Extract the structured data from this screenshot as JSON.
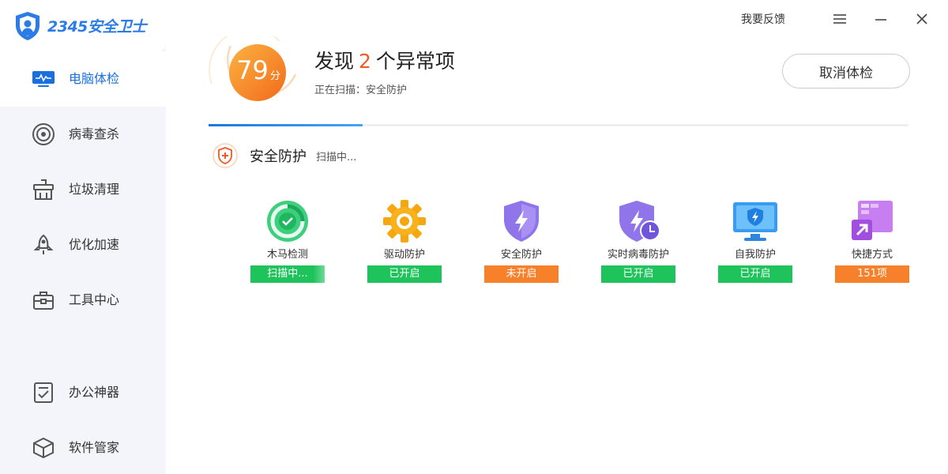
{
  "app": {
    "logo_text": "2345安全卫士"
  },
  "sidebar": {
    "items": [
      {
        "label": "电脑体检",
        "icon": "monitor-icon",
        "active": true
      },
      {
        "label": "病毒查杀",
        "icon": "target-icon",
        "active": false
      },
      {
        "label": "垃圾清理",
        "icon": "broom-icon",
        "active": false
      },
      {
        "label": "优化加速",
        "icon": "rocket-icon",
        "active": false
      },
      {
        "label": "工具中心",
        "icon": "toolbox-icon",
        "active": false
      },
      {
        "label": "办公神器",
        "icon": "checklist-icon",
        "active": false
      },
      {
        "label": "软件管家",
        "icon": "box-icon",
        "active": false
      }
    ]
  },
  "window": {
    "feedback_label": "我要反馈",
    "menu_icon": "hamburger-icon",
    "minimize_icon": "minimize-icon",
    "close_icon": "close-icon"
  },
  "header": {
    "score": "79",
    "score_unit": "分",
    "headline_prefix": "发现",
    "issue_count": "2",
    "headline_suffix": "个异常项",
    "scanning_text": "正在扫描：安全防护",
    "cancel_label": "取消体检",
    "progress": 0.22
  },
  "section": {
    "title": "安全防护",
    "status": "扫描中..."
  },
  "items": [
    {
      "label": "木马检测",
      "status": "扫描中...",
      "icon": "trojan-scan-icon",
      "tone": "scan"
    },
    {
      "label": "驱动防护",
      "status": "已开启",
      "icon": "gear-icon",
      "tone": "green"
    },
    {
      "label": "安全防护",
      "status": "未开启",
      "icon": "shield-bolt-icon",
      "tone": "orange"
    },
    {
      "label": "实时病毒防护",
      "status": "已开启",
      "icon": "shield-clock-icon",
      "tone": "green"
    },
    {
      "label": "自我防护",
      "status": "已开启",
      "icon": "monitor-shield-icon",
      "tone": "green"
    },
    {
      "label": "快捷方式",
      "status": "151项",
      "icon": "shortcut-icon",
      "tone": "orange"
    }
  ],
  "colors": {
    "accent_blue": "#1a6fe0",
    "score_orange": "#f7812b",
    "issue_red": "#f05a23",
    "badge_green": "#1ec35c",
    "badge_orange": "#f7812b"
  }
}
